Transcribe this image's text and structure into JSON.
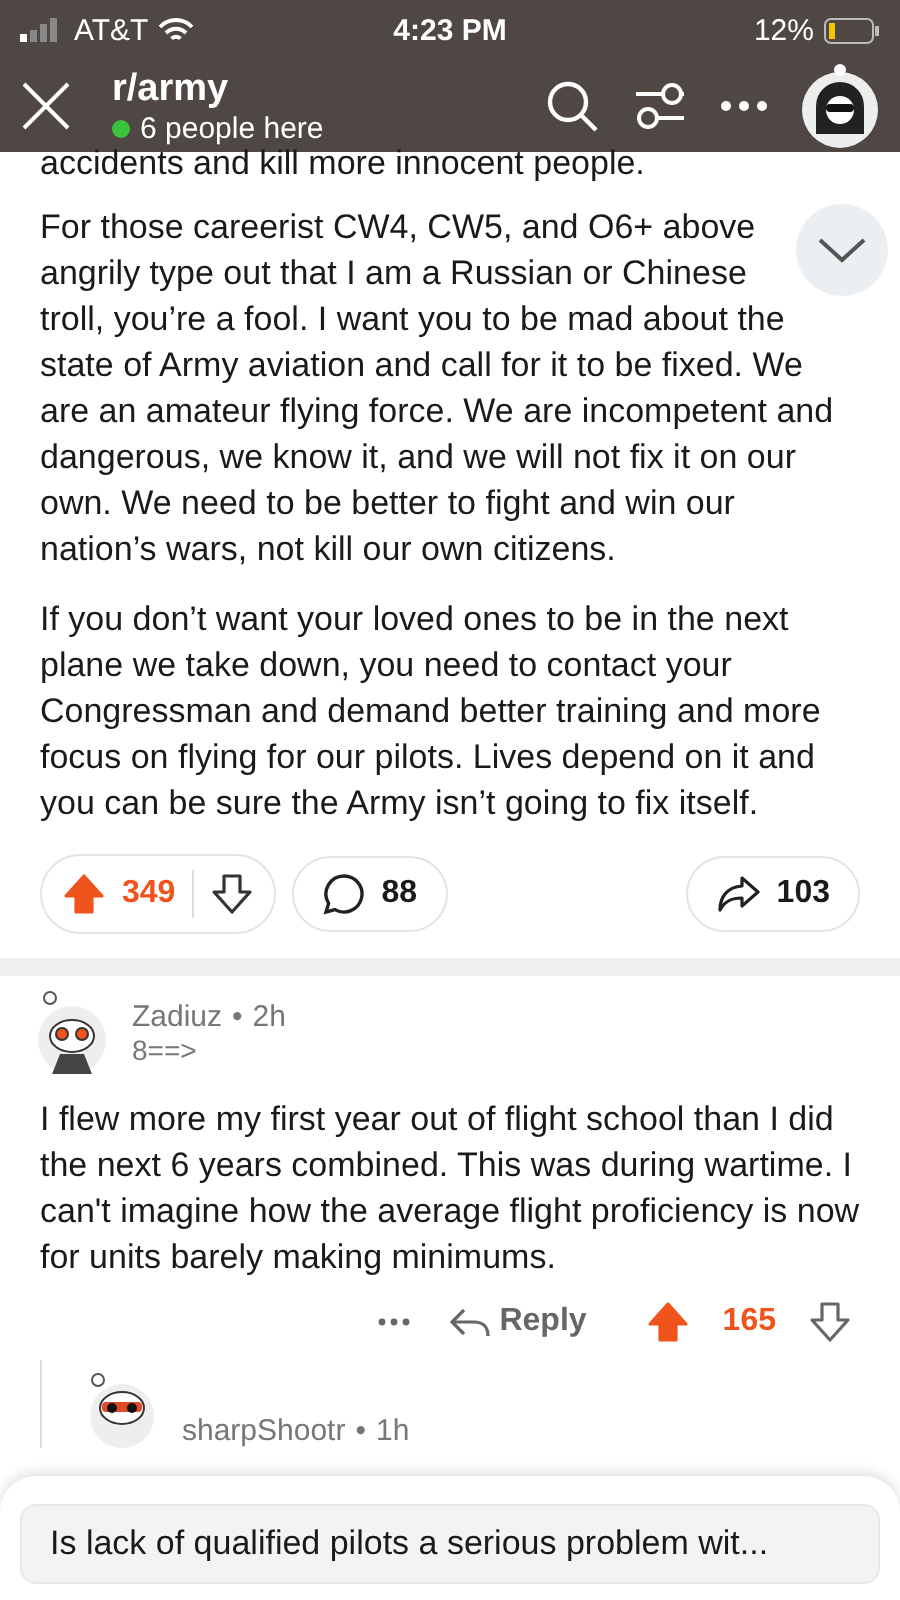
{
  "status_bar": {
    "carrier": "AT&T",
    "time": "4:23 PM",
    "battery": "12%"
  },
  "header": {
    "title": "r/army",
    "online": "6 people here"
  },
  "post": {
    "paragraphs": [
      "accidents and kill more innocent people.",
      "For those careerist CW4, CW5, and O6+ above angrily type out that I am a Russian or Chinese troll, you’re a fool. I want you to be mad about the state of Army aviation and call for it to be fixed. We are an amateur flying force. We are incompetent and dangerous, we know it, and we will not fix it on our own. We need to be better to fight and win our nation’s wars, not kill our own citizens.",
      "If you don’t want your loved ones to be in the next plane we take down, you need to contact your Congressman and demand better training and more focus on flying for our pilots. Lives depend on it and you can be sure the Army isn’t going to fix itself."
    ],
    "votes": "349",
    "upvoted": true,
    "comments": "88",
    "shares": "103"
  },
  "comments": [
    {
      "user": "Zadiuz",
      "sep": "•",
      "age": "2h",
      "flair": "8==>",
      "body": "I flew more my first year out of flight school than I did the next 6 years combined. This was during wartime. I can't imagine how the average flight proficiency is now for units barely making minimums.",
      "reply": "Reply",
      "votes": "165",
      "upvoted": true
    },
    {
      "user": "sharpShootr",
      "sep": "•",
      "age": "1h"
    }
  ],
  "reply_bar": {
    "placeholder": "Is lack of qualified pilots a serious problem wit..."
  }
}
